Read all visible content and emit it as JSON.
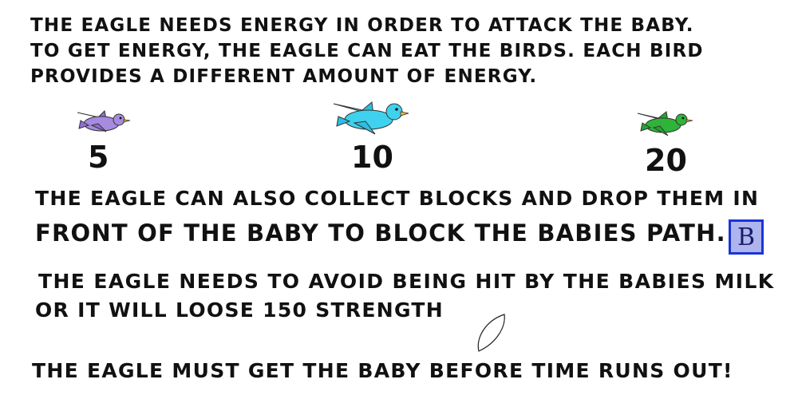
{
  "instructions": {
    "intro_lines": [
      "The eagle needs energy in order to attack the baby.",
      "To get energy, the eagle can eat the birds. Each bird",
      "provides a different amount of energy."
    ],
    "blocks_lines": [
      "The eagle can also collect blocks and drop them in",
      "front of the baby to block the babies path."
    ],
    "milk_lines": [
      "The eagle needs to avoid being hit by the babies milk",
      "or it will loose 150 strength"
    ],
    "time_line": "The eagle must get the baby before time runs out!"
  },
  "birds": [
    {
      "icon": "purple-bird-icon",
      "color": "#a78be0",
      "energy": "5"
    },
    {
      "icon": "blue-bird-icon",
      "color": "#3fd2ee",
      "energy": "10"
    },
    {
      "icon": "green-bird-icon",
      "color": "#2fb43a",
      "energy": "20"
    }
  ],
  "block": {
    "icon": "block-icon",
    "letter": "B",
    "fill": "#aeb4ee",
    "border": "#1a35d6"
  },
  "milk": {
    "icon": "milk-drop-icon"
  }
}
